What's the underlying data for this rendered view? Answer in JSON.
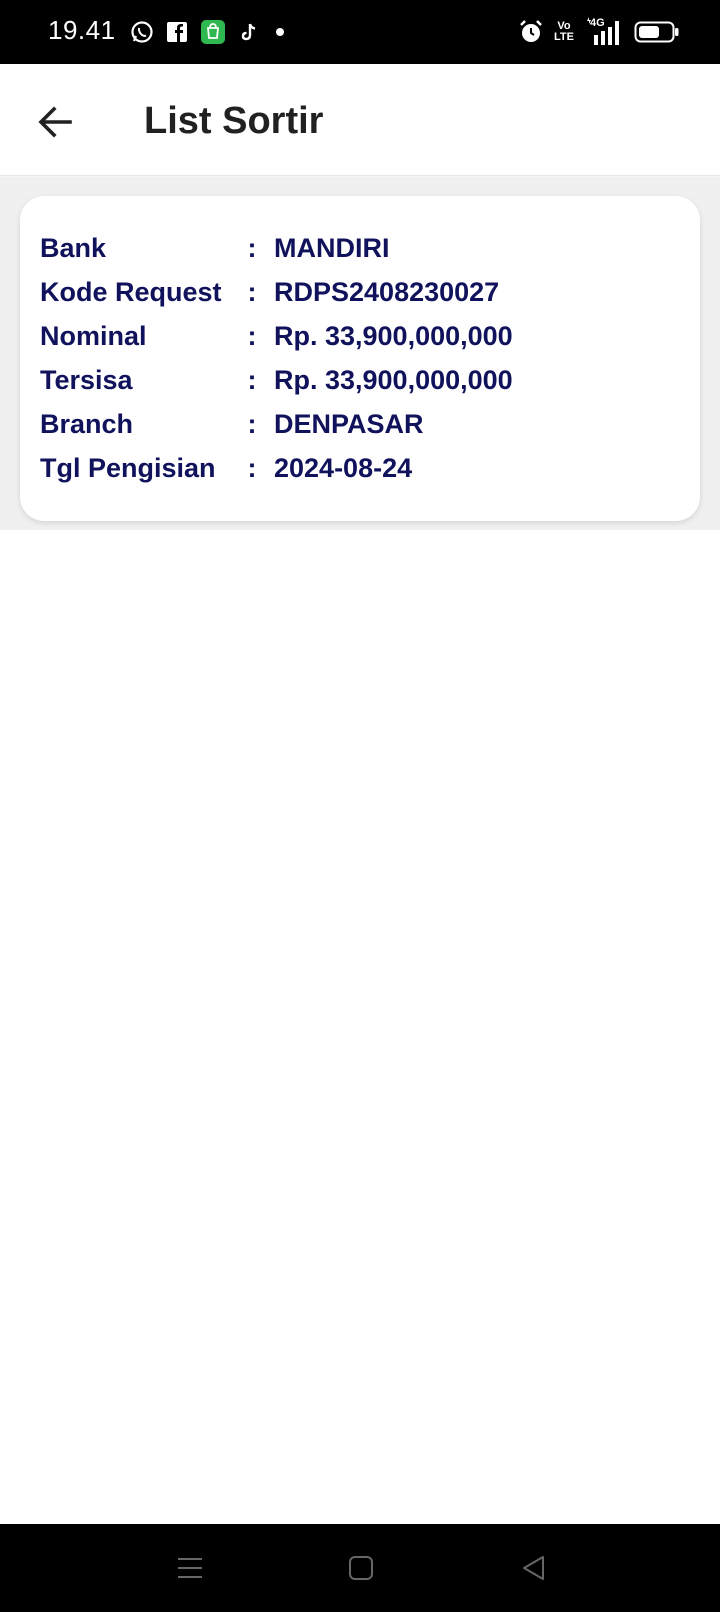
{
  "status_bar": {
    "time": "19.41",
    "left_icons": [
      "whatsapp-icon",
      "facebook-icon",
      "shop-app-icon",
      "tiktok-icon",
      "notification-dot-icon"
    ],
    "right_icons": [
      "alarm-icon",
      "volte-icon",
      "4g-signal-icon",
      "battery-icon"
    ],
    "volte_label_top": "Vo",
    "volte_label_bottom": "LTE",
    "network_label": "4G",
    "shop_color": "#2fb84f"
  },
  "app_bar": {
    "title": "List Sortir",
    "back_icon": "arrow-left-icon"
  },
  "card": {
    "separator": ":",
    "rows": [
      {
        "label": "Bank",
        "value": "MANDIRI"
      },
      {
        "label": "Kode Request",
        "value": "RDPS2408230027"
      },
      {
        "label": "Nominal",
        "value": "Rp. 33,900,000,000"
      },
      {
        "label": "Tersisa",
        "value": "Rp. 33,900,000,000"
      },
      {
        "label": "Branch",
        "value": "DENPASAR"
      },
      {
        "label": "Tgl Pengisian",
        "value": "2024-08-24"
      }
    ],
    "text_color": "#11125c"
  },
  "nav_bar": {
    "buttons": [
      "menu-icon",
      "home-icon",
      "back-triangle-icon"
    ]
  }
}
